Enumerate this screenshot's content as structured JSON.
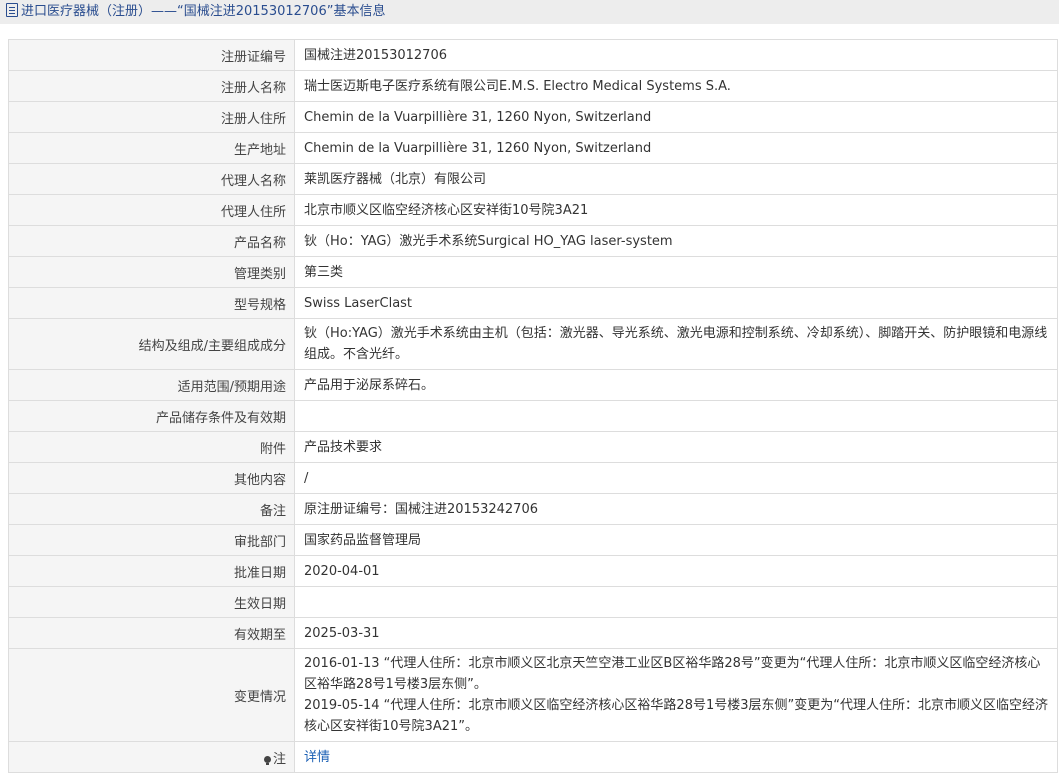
{
  "header": {
    "title": "进口医疗器械（注册）——“国械注进20153012706”基本信息"
  },
  "rows": [
    {
      "label": "注册证编号",
      "value": "国械注进20153012706"
    },
    {
      "label": "注册人名称",
      "value": "瑞士医迈斯电子医疗系统有限公司E.M.S. Electro Medical Systems S.A."
    },
    {
      "label": "注册人住所",
      "value": "Chemin de la Vuarpillière 31, 1260 Nyon, Switzerland"
    },
    {
      "label": "生产地址",
      "value": "Chemin de la Vuarpillière 31, 1260 Nyon, Switzerland"
    },
    {
      "label": "代理人名称",
      "value": "莱凯医疗器械（北京）有限公司"
    },
    {
      "label": "代理人住所",
      "value": "北京市顺义区临空经济核心区安祥街10号院3A21"
    },
    {
      "label": "产品名称",
      "value": "钬（Ho：YAG）激光手术系统Surgical HO_YAG laser-system"
    },
    {
      "label": "管理类别",
      "value": "第三类"
    },
    {
      "label": "型号规格",
      "value": "Swiss LaserClast"
    },
    {
      "label": "结构及组成/主要组成成分",
      "value": "钬（Ho:YAG）激光手术系统由主机（包括：激光器、导光系统、激光电源和控制系统、冷却系统）、脚踏开关、防护眼镜和电源线组成。不含光纤。"
    },
    {
      "label": "适用范围/预期用途",
      "value": "产品用于泌尿系碎石。"
    },
    {
      "label": "产品储存条件及有效期",
      "value": ""
    },
    {
      "label": "附件",
      "value": "产品技术要求"
    },
    {
      "label": "其他内容",
      "value": "/"
    },
    {
      "label": "备注",
      "value": "原注册证编号：国械注进20153242706"
    },
    {
      "label": "审批部门",
      "value": "国家药品监督管理局"
    },
    {
      "label": "批准日期",
      "value": "2020-04-01"
    },
    {
      "label": "生效日期",
      "value": ""
    },
    {
      "label": "有效期至",
      "value": "2025-03-31"
    }
  ],
  "changes": {
    "label": "变更情况",
    "entries": [
      "2016-01-13 “代理人住所：北京市顺义区北京天竺空港工业区B区裕华路28号”变更为“代理人住所：北京市顺义区临空经济核心区裕华路28号1号楼3层东侧”。",
      "2019-05-14 “代理人住所：北京市顺义区临空经济核心区裕华路28号1号楼3层东侧”变更为“代理人住所：北京市顺义区临空经济核心区安祥街10号院3A21”。"
    ]
  },
  "note": {
    "label": "注",
    "link": "详情"
  }
}
